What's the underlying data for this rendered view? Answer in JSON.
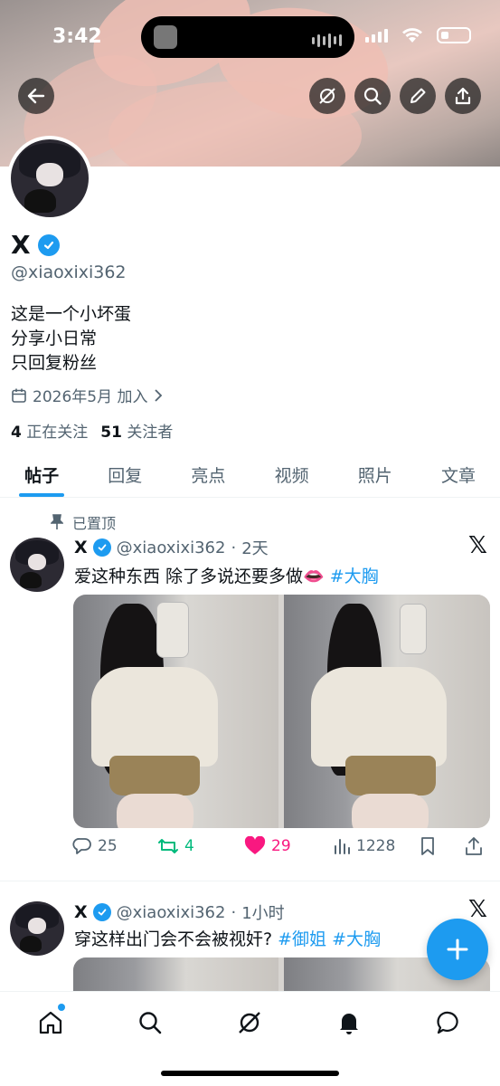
{
  "status_bar": {
    "time": "3:42"
  },
  "profile": {
    "display_name": "X",
    "handle": "@xiaoxixi362",
    "bio": [
      "这是一个小坏蛋",
      "分享小日常",
      "只回复粉丝"
    ],
    "joined": "2026年5月 加入",
    "following_count": "4",
    "following_label": "正在关注",
    "followers_count": "51",
    "followers_label": "关注者"
  },
  "tabs": [
    {
      "label": "帖子",
      "active": true
    },
    {
      "label": "回复",
      "active": false
    },
    {
      "label": "亮点",
      "active": false
    },
    {
      "label": "视频",
      "active": false
    },
    {
      "label": "照片",
      "active": false
    },
    {
      "label": "文章",
      "active": false
    }
  ],
  "posts": [
    {
      "pinned_label": "已置顶",
      "name": "X",
      "handle": "@xiaoxixi362",
      "time": "2天",
      "text": "爱这种东西 除了多说还要多做👄",
      "hashtag": "#大胸",
      "replies": "25",
      "reposts": "4",
      "likes": "29",
      "views": "1228"
    },
    {
      "name": "X",
      "handle": "@xiaoxixi362",
      "time": "1小时",
      "text": "穿这样出门会不会被视奸?",
      "hashtags": [
        "#御姐",
        "#大胸"
      ]
    }
  ],
  "colors": {
    "accent": "#1d9bf0",
    "like": "#f91880",
    "repost": "#00ba7c",
    "muted": "#536471"
  },
  "icons": [
    "back-arrow-icon",
    "grok-icon",
    "search-icon",
    "edit-icon",
    "share-icon",
    "calendar-icon",
    "pin-icon",
    "reply-icon",
    "repost-icon",
    "heart-icon",
    "views-icon",
    "bookmark-icon",
    "home-icon",
    "bell-icon",
    "messages-icon",
    "plus-icon"
  ]
}
